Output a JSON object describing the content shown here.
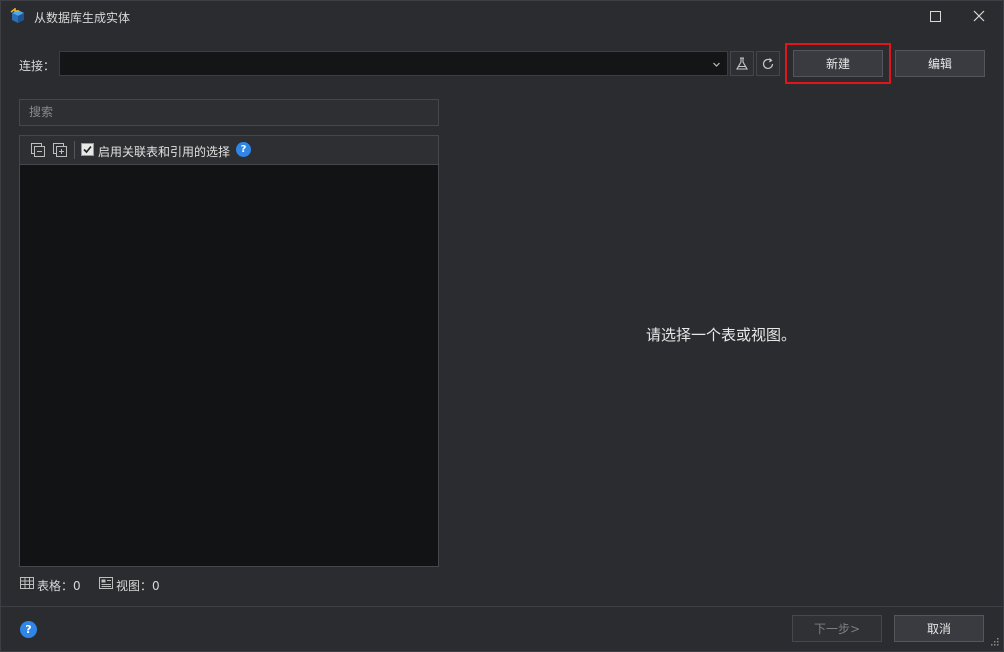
{
  "window": {
    "title": "从数据库生成实体"
  },
  "connection": {
    "label": "连接：",
    "selected_value": "",
    "new_label": "新建",
    "edit_label": "编辑"
  },
  "search": {
    "placeholder": "搜索"
  },
  "tree": {
    "checkbox_label": "启用关联表和引用的选择",
    "checkbox_checked": true,
    "items": []
  },
  "stats": {
    "tables_label": "表格：0",
    "views_label": "视图：0"
  },
  "main": {
    "empty_message": "请选择一个表或视图。"
  },
  "footer": {
    "next_label": "下一步>",
    "cancel_label": "取消"
  },
  "colors": {
    "accent": "#2f86e6",
    "highlight": "#e0161b"
  }
}
